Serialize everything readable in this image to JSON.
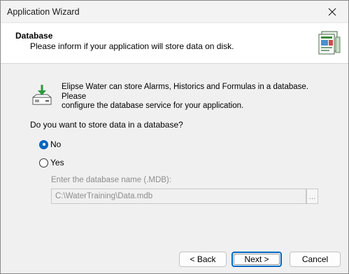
{
  "window": {
    "title": "Application Wizard"
  },
  "header": {
    "title": "Database",
    "subtitle": "Please inform if your application will store data on disk."
  },
  "content": {
    "info_line1": "Elipse Water can store Alarms, Historics and Formulas in a database. Please",
    "info_line2": "configure the database service for your application.",
    "question": "Do you want to store data in a database?",
    "options": [
      {
        "label": "No",
        "selected": true
      },
      {
        "label": "Yes",
        "selected": false
      }
    ],
    "db_name_label": "Enter the database name (.MDB):",
    "db_name_value": "C:\\WaterTraining\\Data.mdb",
    "browse_label": "..."
  },
  "buttons": {
    "back": "< Back",
    "next": "Next >",
    "cancel": "Cancel"
  },
  "colors": {
    "accent": "#0067c0",
    "disabled_text": "#8d8d8d"
  }
}
